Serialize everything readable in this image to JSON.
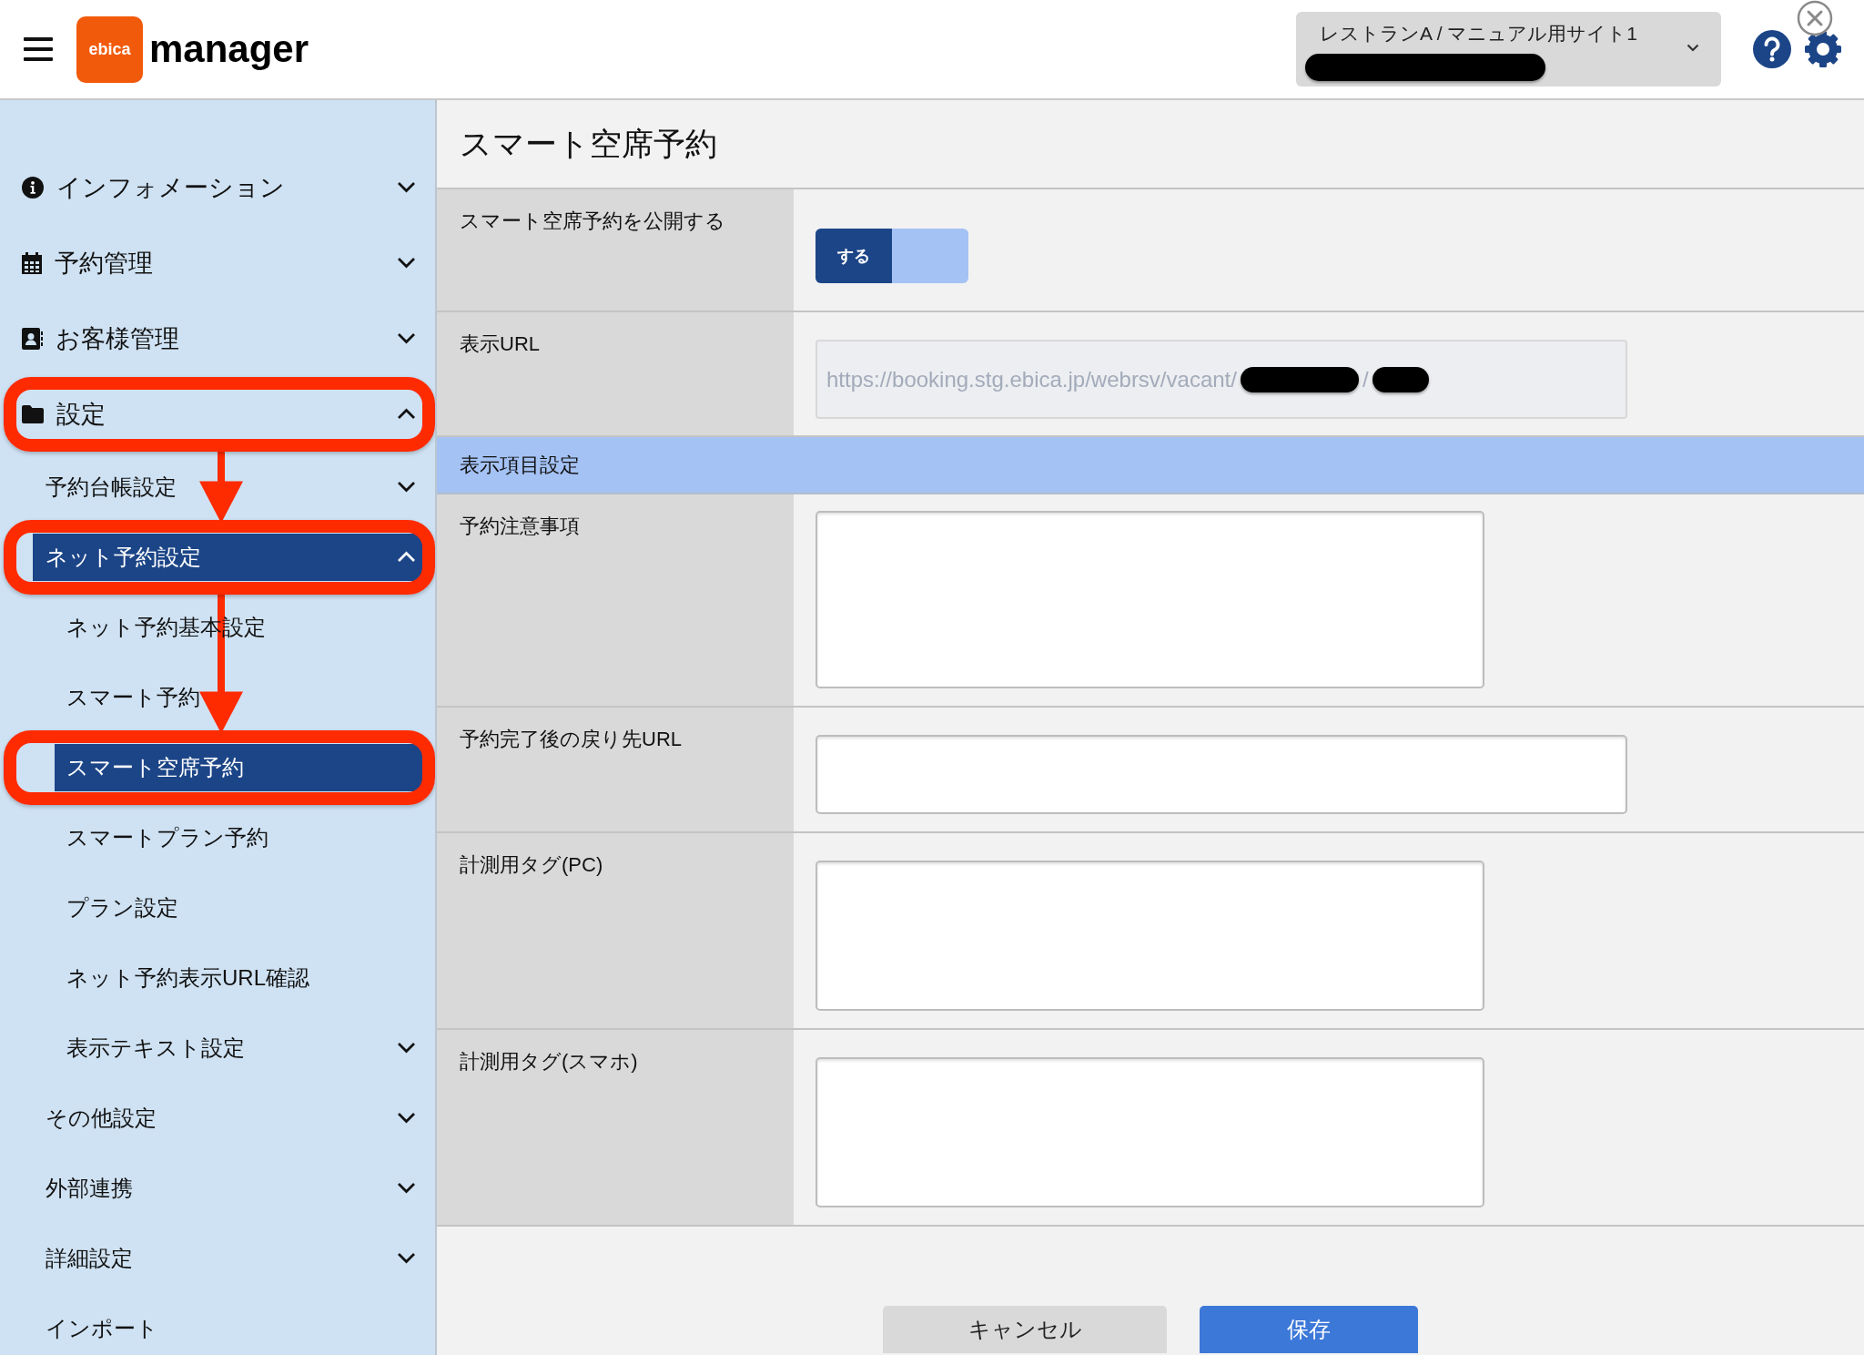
{
  "header": {
    "logo": {
      "badge": "ebica",
      "name": "manager"
    },
    "site_selector": {
      "label": "レストランA / マニュアル用サイト1",
      "redacted_line": true
    }
  },
  "sidebar": {
    "items": [
      {
        "label": "インフォメーション",
        "expanded": false,
        "selected": false,
        "annotated": false
      },
      {
        "label": "予約管理",
        "expanded": false,
        "selected": false,
        "annotated": false
      },
      {
        "label": "お客様管理",
        "expanded": false,
        "selected": false,
        "annotated": false
      },
      {
        "label": "設定",
        "expanded": true,
        "selected": false,
        "annotated": true,
        "children": [
          {
            "label": "予約台帳設定",
            "expanded": false,
            "selected": false,
            "annotated": false
          },
          {
            "label": "ネット予約設定",
            "expanded": true,
            "selected": true,
            "annotated": true,
            "children": [
              {
                "label": "ネット予約基本設定",
                "selected": false,
                "annotated": false
              },
              {
                "label": "スマート予約",
                "selected": false,
                "annotated": false
              },
              {
                "label": "スマート空席予約",
                "selected": true,
                "annotated": true
              },
              {
                "label": "スマートプラン予約",
                "selected": false,
                "annotated": false
              },
              {
                "label": "プラン設定",
                "selected": false,
                "annotated": false
              },
              {
                "label": "ネット予約表示URL確認",
                "selected": false,
                "annotated": false
              },
              {
                "label": "表示テキスト設定",
                "expanded": false,
                "selected": false,
                "annotated": false
              }
            ]
          },
          {
            "label": "その他設定",
            "expanded": false,
            "selected": false,
            "annotated": false
          },
          {
            "label": "外部連携",
            "expanded": false,
            "selected": false,
            "annotated": false
          },
          {
            "label": "詳細設定",
            "expanded": false,
            "selected": false,
            "annotated": false
          },
          {
            "label": "インポート",
            "selected": false,
            "annotated": false
          }
        ]
      }
    ]
  },
  "page_title": "スマート空席予約",
  "form": {
    "rows": [
      {
        "kind": "toggle",
        "label": "スマート空席予約を公開する",
        "toggle": {
          "label": "する",
          "on": true
        }
      },
      {
        "kind": "url",
        "label": "表示URL",
        "segments": [
          {
            "kind": "text",
            "text": "https://booking.stg.ebica.jp/webrsv/vacant/"
          },
          {
            "kind": "redacted"
          },
          {
            "kind": "text",
            "text": "/"
          },
          {
            "kind": "redacted"
          }
        ]
      },
      {
        "kind": "section",
        "label": "表示項目設定"
      },
      {
        "kind": "longtext",
        "label": "予約注意事項"
      },
      {
        "kind": "input",
        "label": "予約完了後の戻り先URL"
      },
      {
        "kind": "textarea",
        "label": "計測用タグ(PC)"
      },
      {
        "kind": "textarea",
        "label": "計測用タグ(スマホ)"
      }
    ]
  },
  "buttons": [
    {
      "kind": "cancel",
      "label": "キャンセル"
    },
    {
      "kind": "save",
      "label": "保存"
    }
  ]
}
